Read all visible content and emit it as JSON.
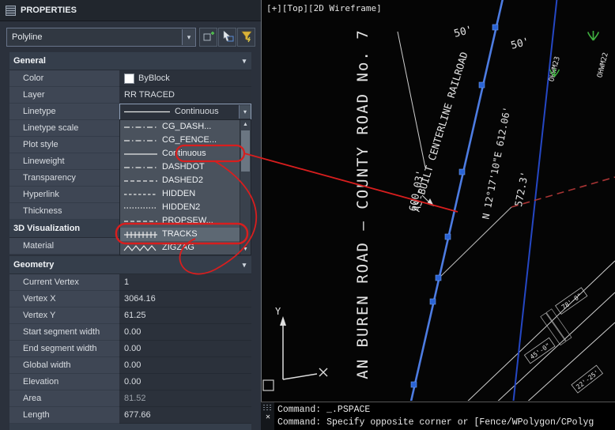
{
  "glyphs": {
    "chevron_down": "▾",
    "close": "✕",
    "scroll_up": "▲",
    "scroll_down": "▼"
  },
  "palette": {
    "title": "PROPERTIES",
    "type_selector": "Polyline",
    "sections": [
      {
        "label": "General",
        "rows": [
          {
            "label": "Color",
            "value": "ByBlock"
          },
          {
            "label": "Layer",
            "value": "RR TRACED"
          },
          {
            "label": "Linetype",
            "value": "Continuous"
          },
          {
            "label": "Linetype scale",
            "value": ""
          },
          {
            "label": "Plot style",
            "value": ""
          },
          {
            "label": "Lineweight",
            "value": ""
          },
          {
            "label": "Transparency",
            "value": ""
          },
          {
            "label": "Hyperlink",
            "value": ""
          },
          {
            "label": "Thickness",
            "value": ""
          }
        ]
      },
      {
        "label": "3D Visualization",
        "rows": [
          {
            "label": "Material",
            "value": ""
          }
        ]
      },
      {
        "label": "Geometry",
        "rows": [
          {
            "label": "Current Vertex",
            "value": "1"
          },
          {
            "label": "Vertex X",
            "value": "3064.16"
          },
          {
            "label": "Vertex Y",
            "value": "61.25"
          },
          {
            "label": "Start segment width",
            "value": "0.00"
          },
          {
            "label": "End segment width",
            "value": "0.00"
          },
          {
            "label": "Global width",
            "value": "0.00"
          },
          {
            "label": "Elevation",
            "value": "0.00"
          },
          {
            "label": "Area",
            "value": "81.52"
          },
          {
            "label": "Length",
            "value": "677.66"
          }
        ]
      }
    ],
    "linetype_list": {
      "items": [
        {
          "name": "CG_DASH...",
          "pattern": "dashdot"
        },
        {
          "name": "CG_FENCE...",
          "pattern": "dashdot"
        },
        {
          "name": "Continuous",
          "pattern": "solid"
        },
        {
          "name": "DASHDOT",
          "pattern": "dashdot"
        },
        {
          "name": "DASHED2",
          "pattern": "dashed"
        },
        {
          "name": "HIDDEN",
          "pattern": "dashed-short"
        },
        {
          "name": "HIDDEN2",
          "pattern": "dotted"
        },
        {
          "name": "PROPSEW...",
          "pattern": "dashed"
        },
        {
          "name": "TRACKS",
          "pattern": "tracks",
          "highlighted": true
        },
        {
          "name": "ZIGZAG",
          "pattern": "zigzag"
        }
      ]
    }
  },
  "drawing": {
    "viewport_label": "[+][Top][2D Wireframe]",
    "labels": {
      "road": "AN BUREN ROAD – COUNTY ROAD No. 7",
      "centerline": "AS-BUILT CENTERLINE RAILROAD",
      "bearing": "N 12°17'10\"E 612.06'",
      "dist_left": "600.03'",
      "dist_right": "572.3'",
      "offset_left": "50'",
      "offset_right": "50'",
      "ohwm23": "OHWM23",
      "ohwm22": "OHWM22",
      "dim_a": "78'-0\"",
      "dim_b": "45'-0\"",
      "dim_c": "22'-25'",
      "ucs_y": "Y"
    },
    "colors": {
      "centerline": "#4d7ce2",
      "offset_line": "#2547c4",
      "grip": "#2a63d4",
      "red_dashed": "#a83434",
      "grass": "#3fae3f",
      "annotation_red": "#d81e1e"
    }
  },
  "command": {
    "lines": [
      "Command: _.PSPACE",
      "Command: Specify opposite corner or [Fence/WPolygon/CPolyg"
    ]
  }
}
